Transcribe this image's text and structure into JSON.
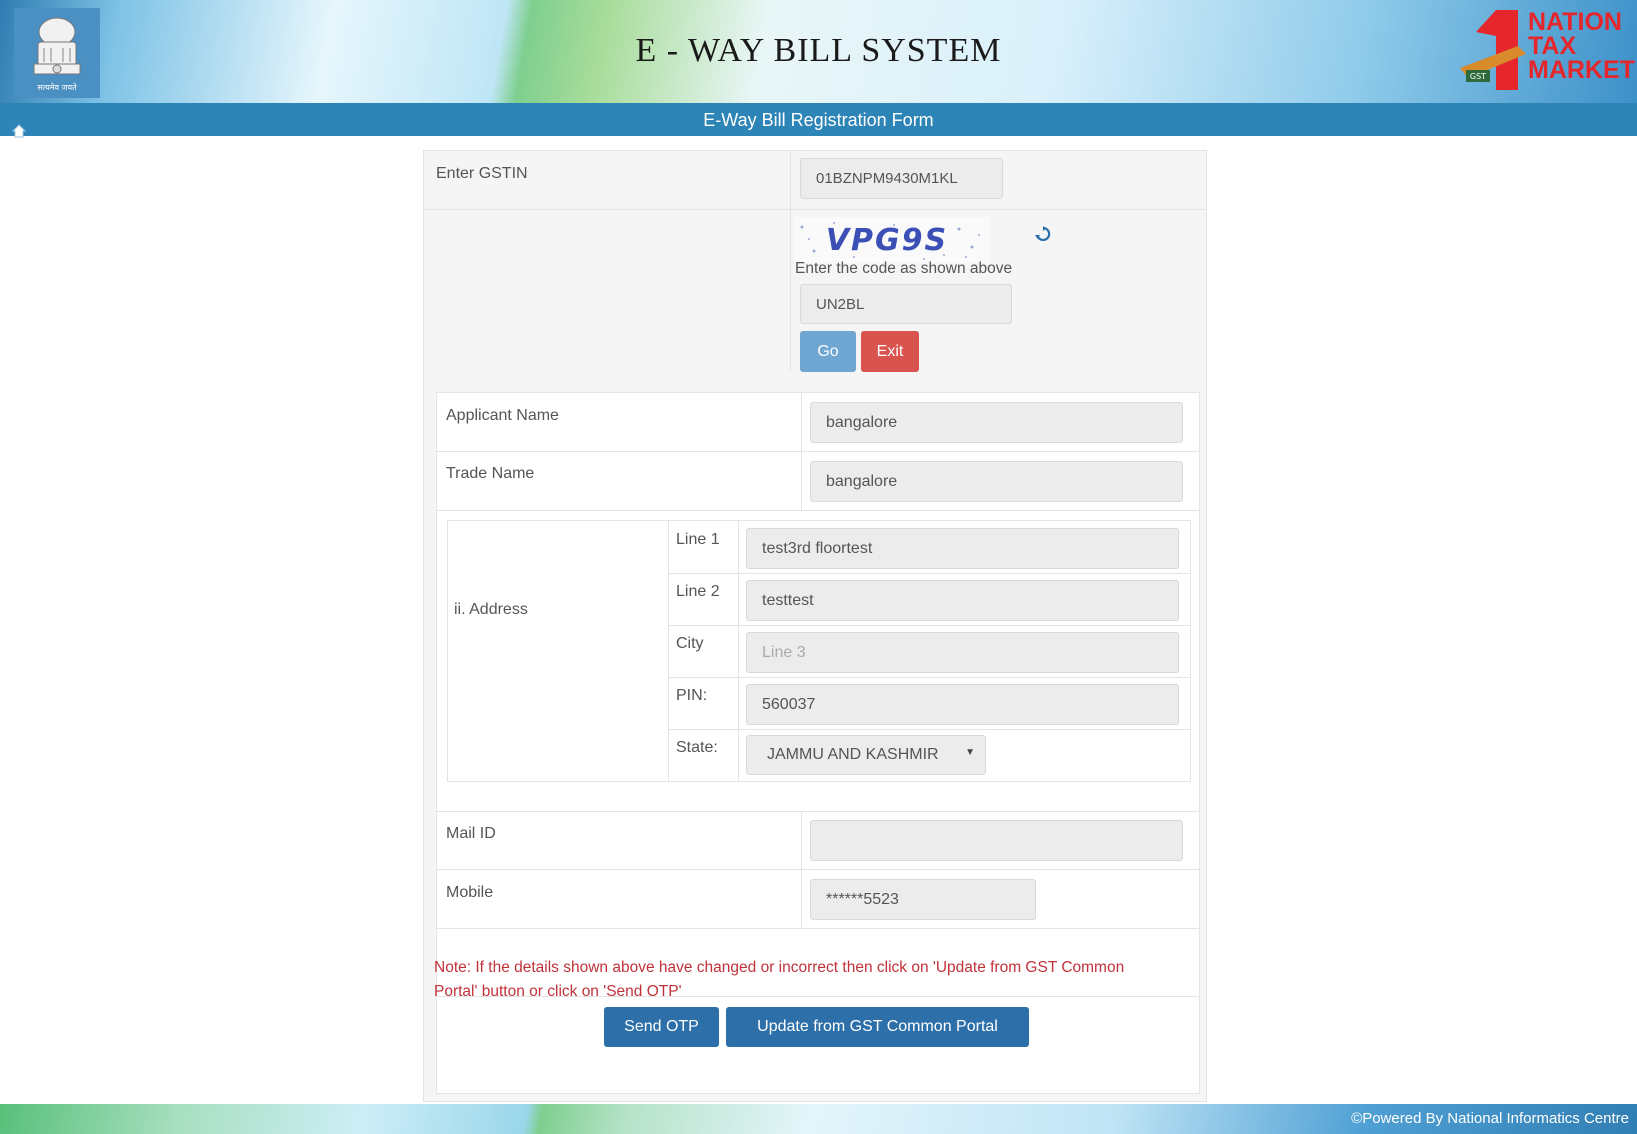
{
  "header": {
    "title": "E - WAY BILL SYSTEM",
    "emblem_caption": "सत्यमेव जयते",
    "brand": [
      "NATION",
      "TAX",
      "MARKET"
    ],
    "brand_badge": "GST"
  },
  "subheader": {
    "title": "E-Way Bill Registration Form"
  },
  "gstin": {
    "label": "Enter GSTIN",
    "value": "01BZNPM9430M1KL"
  },
  "captcha": {
    "image_text": "VPG9S",
    "instruction": "Enter the code as shown above",
    "value": "UN2BL",
    "go_label": "Go",
    "exit_label": "Exit"
  },
  "details": {
    "applicant_name": {
      "label": "Applicant Name",
      "value": "bangalore"
    },
    "trade_name": {
      "label": "Trade Name",
      "value": "bangalore"
    },
    "address": {
      "label": "ii. Address",
      "line1": {
        "label": "Line 1",
        "value": "test3rd floortest"
      },
      "line2": {
        "label": "Line 2",
        "value": "testtest"
      },
      "city": {
        "label": "City",
        "placeholder": "Line 3"
      },
      "pin": {
        "label": "PIN:",
        "value": "560037"
      },
      "state": {
        "label": "State:",
        "value": "JAMMU AND KASHMIR"
      }
    },
    "mail": {
      "label": "Mail ID",
      "value": ""
    },
    "mobile": {
      "label": "Mobile",
      "value": "******5523"
    }
  },
  "note": "Note: If the details shown above have changed or incorrect then click on 'Update from GST Common Portal' button or click on 'Send OTP'",
  "actions": {
    "send_otp": "Send OTP",
    "update": "Update from GST Common Portal"
  },
  "footer": {
    "text": "©Powered By National Informatics Centre"
  },
  "colors": {
    "primary": "#2d84b6",
    "go": "#6fa6d2",
    "exit": "#d9534f",
    "note": "#c0323a",
    "brand_red": "#e5262c"
  }
}
